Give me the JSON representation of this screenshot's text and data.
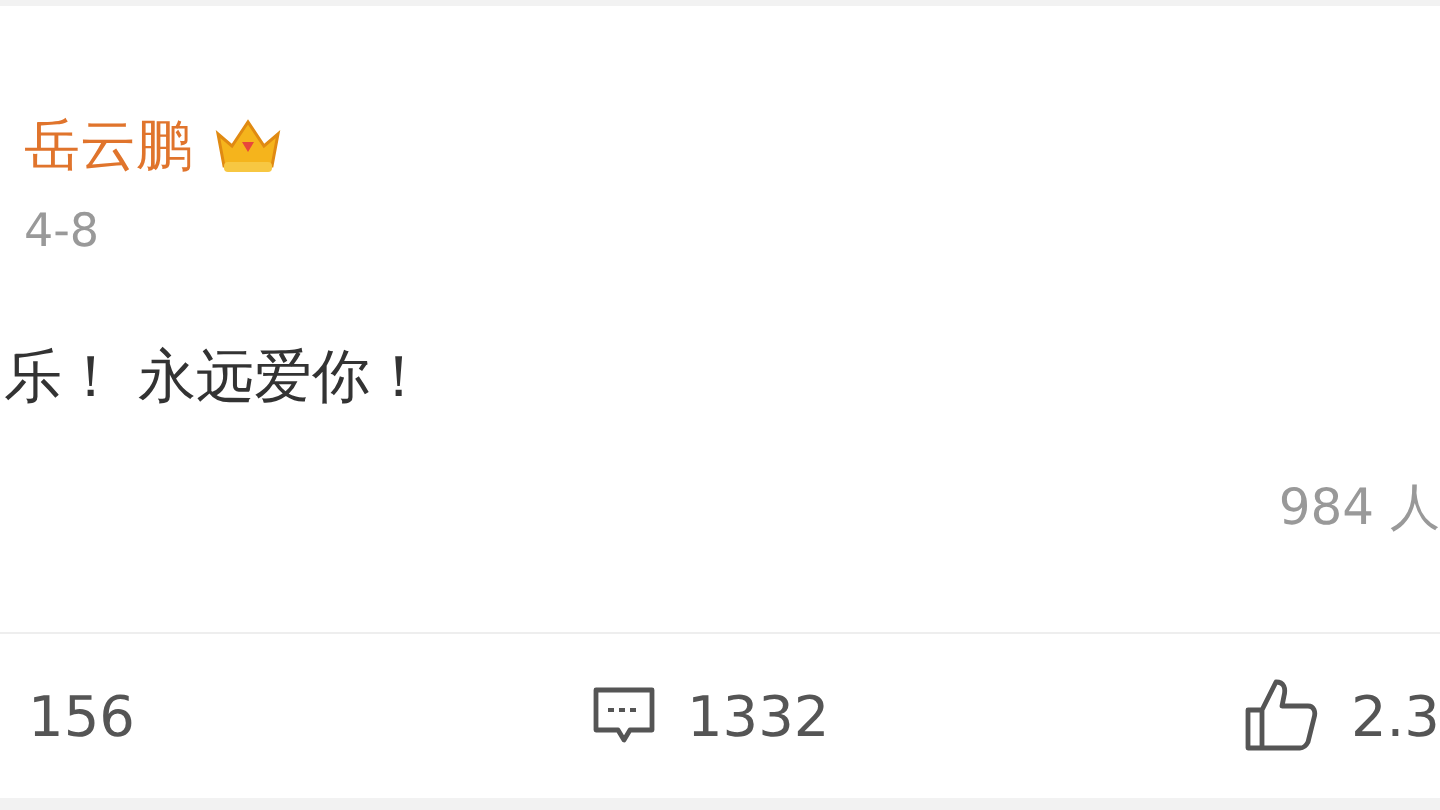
{
  "post": {
    "author": "岳云鹏",
    "date": "4-8",
    "text": "乐！ 永远爱你！",
    "views": "984 人"
  },
  "actions": [
    {
      "kind": "repost",
      "count": "156"
    },
    {
      "kind": "comment",
      "count": "1332"
    },
    {
      "kind": "like",
      "count": "2.3"
    }
  ]
}
